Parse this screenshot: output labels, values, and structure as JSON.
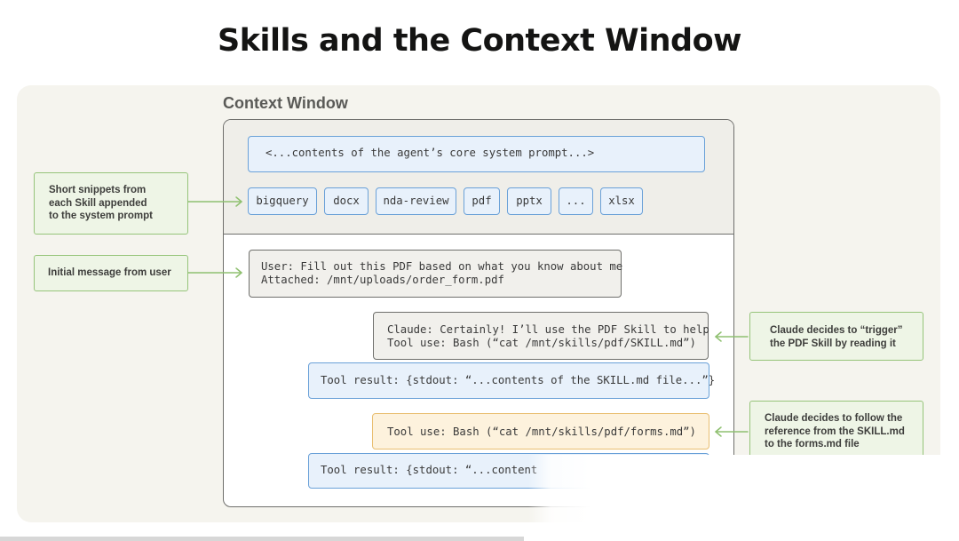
{
  "title": "Skills and the Context Window",
  "context_window": {
    "title": "Context Window",
    "system_prompt": "<...contents of the agent’s core system prompt...>",
    "skills": [
      "bigquery",
      "docx",
      "nda-review",
      "pdf",
      "pptx",
      "...",
      "xlsx"
    ],
    "messages": {
      "user": "User: Fill out this PDF based on what you know about me\nAttached: /mnt/uploads/order_form.pdf",
      "claude": "Claude: Certainly! I’ll use the PDF Skill to help\nTool use: Bash (“cat /mnt/skills/pdf/SKILL.md”)",
      "tool_result_1": "Tool result: {stdout: “...contents of the SKILL.md file...”}",
      "tool_use_2": "Tool use: Bash (“cat /mnt/skills/pdf/forms.md”)",
      "tool_result_2": "Tool result: {stdout: “...content"
    }
  },
  "callouts": {
    "snippets": "Short snippets from\neach Skill appended\nto the system prompt",
    "user_message": "Initial message from user",
    "trigger": "Claude decides to “trigger”\nthe PDF Skill by reading it",
    "follow": "Claude decides to follow the\nreference from the SKILL.md\nto the forms.md file"
  },
  "colors": {
    "blue_fill": "#e8f1fb",
    "blue_border": "#6aa1d8",
    "callout_fill": "#eef5e6",
    "callout_border": "#96c47a",
    "orange_border": "#e9bf72",
    "panel_bg": "#f5f4ee"
  }
}
